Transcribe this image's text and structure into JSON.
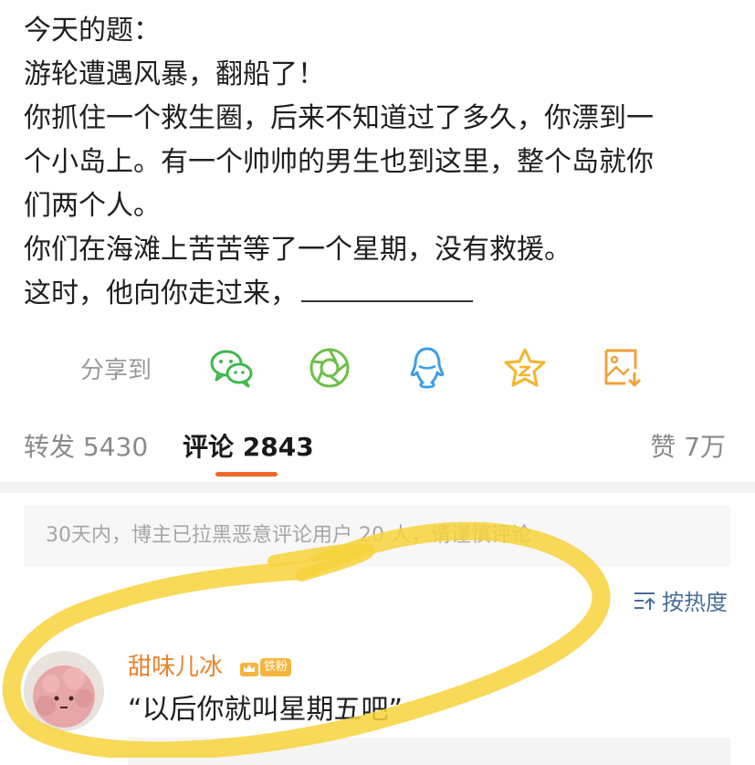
{
  "post": {
    "lines": [
      "今天的题：",
      "游轮遭遇风暴，翻船了！",
      "你抓住一个救生圈，后来不知道过了多久，你漂到一",
      "个小岛上。有一个帅帅的男生也到这里，整个岛就你",
      "们两个人。",
      "你们在海滩上苦苦等了一个星期，没有救援。",
      "这时，他向你走过来，"
    ]
  },
  "share": {
    "label": "分享到",
    "icons": [
      "wechat-icon",
      "moments-icon",
      "qq-icon",
      "qzone-icon",
      "save-image-icon"
    ]
  },
  "tabs": {
    "repost": "转发 5430",
    "comment": "评论 2843",
    "like": "赞 7万"
  },
  "notice": "30天内，博主已拉黑恶意评论用户 20 人，请谨慎评论",
  "sort": {
    "label": "按热度"
  },
  "comment": {
    "username": "甜味儿冰",
    "badge": "铁粉",
    "text": "“以后你就叫星期五吧”"
  },
  "colors": {
    "accent": "#f06a2a",
    "username": "#e8832e",
    "link": "#4a6d9c",
    "highlight": "#f7d23b"
  }
}
